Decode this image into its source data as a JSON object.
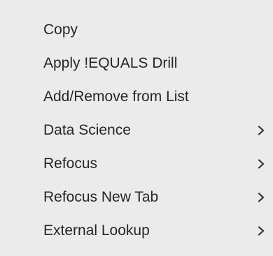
{
  "context_menu": {
    "items": [
      {
        "label": "Copy",
        "has_submenu": false
      },
      {
        "label": "Apply !EQUALS Drill",
        "has_submenu": false
      },
      {
        "label": "Add/Remove from List",
        "has_submenu": false
      },
      {
        "label": "Data Science",
        "has_submenu": true,
        "submenu_icon": "chevron-right-icon"
      },
      {
        "label": "Refocus",
        "has_submenu": true,
        "submenu_icon": "chevron-right-icon"
      },
      {
        "label": "Refocus New Tab",
        "has_submenu": true,
        "submenu_icon": "chevron-right-icon"
      },
      {
        "label": "External Lookup",
        "has_submenu": true,
        "submenu_icon": "chevron-right-icon"
      }
    ],
    "colors": {
      "background": "#ebebeb",
      "text": "#262626",
      "chevron": "#333333"
    }
  }
}
